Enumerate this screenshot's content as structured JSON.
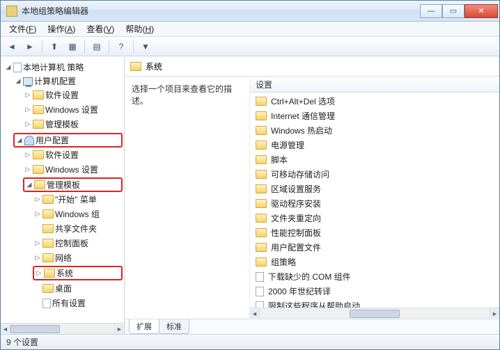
{
  "window": {
    "title": "本地组策略编辑器"
  },
  "menubar": [
    {
      "label": "文件",
      "key": "F"
    },
    {
      "label": "操作",
      "key": "A"
    },
    {
      "label": "查看",
      "key": "V"
    },
    {
      "label": "帮助",
      "key": "H"
    }
  ],
  "tree": {
    "root": "本地计算机 策略",
    "computer_config": "计算机配置",
    "cc_software": "软件设置",
    "cc_windows": "Windows 设置",
    "cc_admin": "管理模板",
    "user_config": "用户配置",
    "uc_software": "软件设置",
    "uc_windows": "Windows 设置",
    "uc_admin": "管理模板",
    "start_menu": "\"开始\" 菜单",
    "win_components": "Windows 组",
    "shared_folders": "共享文件夹",
    "control_panel": "控制面板",
    "network": "网络",
    "system": "系统",
    "desktop": "桌面",
    "all_settings": "所有设置"
  },
  "header": {
    "current": "系统"
  },
  "detail": {
    "prompt": "选择一个项目来查看它的描述。"
  },
  "list": {
    "header": "设置",
    "items": [
      {
        "label": "Ctrl+Alt+Del 选项",
        "icon": "folder"
      },
      {
        "label": "Internet 通信管理",
        "icon": "folder"
      },
      {
        "label": "Windows 热启动",
        "icon": "folder"
      },
      {
        "label": "电源管理",
        "icon": "folder"
      },
      {
        "label": "脚本",
        "icon": "folder"
      },
      {
        "label": "可移动存储访问",
        "icon": "folder"
      },
      {
        "label": "区域设置服务",
        "icon": "folder"
      },
      {
        "label": "驱动程序安装",
        "icon": "folder"
      },
      {
        "label": "文件夹重定向",
        "icon": "folder"
      },
      {
        "label": "性能控制面板",
        "icon": "folder"
      },
      {
        "label": "用户配置文件",
        "icon": "folder"
      },
      {
        "label": "组策略",
        "icon": "folder"
      },
      {
        "label": "下载缺少的 COM 组件",
        "icon": "doc"
      },
      {
        "label": "2000 年世纪转译",
        "icon": "doc"
      },
      {
        "label": "限制这些程序从帮助启动",
        "icon": "doc"
      }
    ]
  },
  "tabs": {
    "extended": "扩展",
    "standard": "标准"
  },
  "status": {
    "text": "9 个设置"
  },
  "highlights": [
    "user_config",
    "uc_admin",
    "system"
  ]
}
